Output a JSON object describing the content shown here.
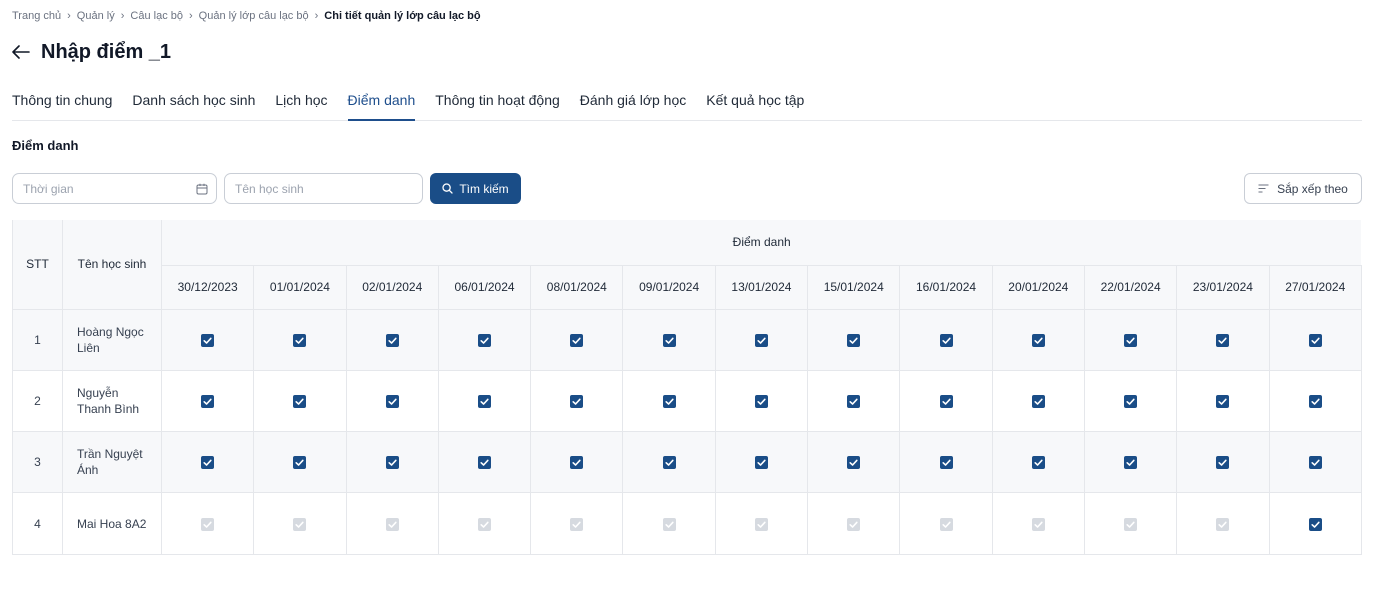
{
  "breadcrumb": [
    "Trang chủ",
    "Quản lý",
    "Câu lạc bộ",
    "Quản lý lớp câu lạc bộ",
    "Chi tiết quản lý lớp câu lạc bộ"
  ],
  "page_title": "Nhập điểm _1",
  "tabs": [
    {
      "label": "Thông tin chung",
      "active": false
    },
    {
      "label": "Danh sách học sinh",
      "active": false
    },
    {
      "label": "Lịch học",
      "active": false
    },
    {
      "label": "Điểm danh",
      "active": true
    },
    {
      "label": "Thông tin hoạt động",
      "active": false
    },
    {
      "label": "Đánh giá lớp học",
      "active": false
    },
    {
      "label": "Kết quả học tập",
      "active": false
    }
  ],
  "section_title": "Điểm danh",
  "filters": {
    "time_placeholder": "Thời gian",
    "name_placeholder": "Tên học sinh",
    "search_label": "Tìm kiếm",
    "sort_label": "Sắp xếp theo"
  },
  "table": {
    "stt_header": "STT",
    "name_header": "Tên học sinh",
    "group_header": "Điểm danh",
    "dates": [
      "30/12/2023",
      "01/01/2024",
      "02/01/2024",
      "06/01/2024",
      "08/01/2024",
      "09/01/2024",
      "13/01/2024",
      "15/01/2024",
      "16/01/2024",
      "20/01/2024",
      "22/01/2024",
      "23/01/2024",
      "27/01/2024"
    ],
    "rows": [
      {
        "stt": "1",
        "name": "Hoàng Ngọc Liên",
        "checks": [
          true,
          true,
          true,
          true,
          true,
          true,
          true,
          true,
          true,
          true,
          true,
          true,
          true
        ],
        "disabled": [
          false,
          false,
          false,
          false,
          false,
          false,
          false,
          false,
          false,
          false,
          false,
          false,
          false
        ]
      },
      {
        "stt": "2",
        "name": "Nguyễn Thanh Bình",
        "checks": [
          true,
          true,
          true,
          true,
          true,
          true,
          true,
          true,
          true,
          true,
          true,
          true,
          true
        ],
        "disabled": [
          false,
          false,
          false,
          false,
          false,
          false,
          false,
          false,
          false,
          false,
          false,
          false,
          false
        ]
      },
      {
        "stt": "3",
        "name": "Trần Nguyệt Ánh",
        "checks": [
          true,
          true,
          true,
          true,
          true,
          true,
          true,
          true,
          true,
          true,
          true,
          true,
          true
        ],
        "disabled": [
          false,
          false,
          false,
          false,
          false,
          false,
          false,
          false,
          false,
          false,
          false,
          false,
          false
        ]
      },
      {
        "stt": "4",
        "name": "Mai Hoa 8A2",
        "checks": [
          true,
          true,
          true,
          true,
          true,
          true,
          true,
          true,
          true,
          true,
          true,
          true,
          true
        ],
        "disabled": [
          true,
          true,
          true,
          true,
          true,
          true,
          true,
          true,
          true,
          true,
          true,
          true,
          false
        ]
      }
    ]
  },
  "colors": {
    "primary": "#1a4d87",
    "active_tab": "#1e4e8c",
    "disabled_check": "#d6dae0",
    "header_bg": "#f7f8fa"
  }
}
